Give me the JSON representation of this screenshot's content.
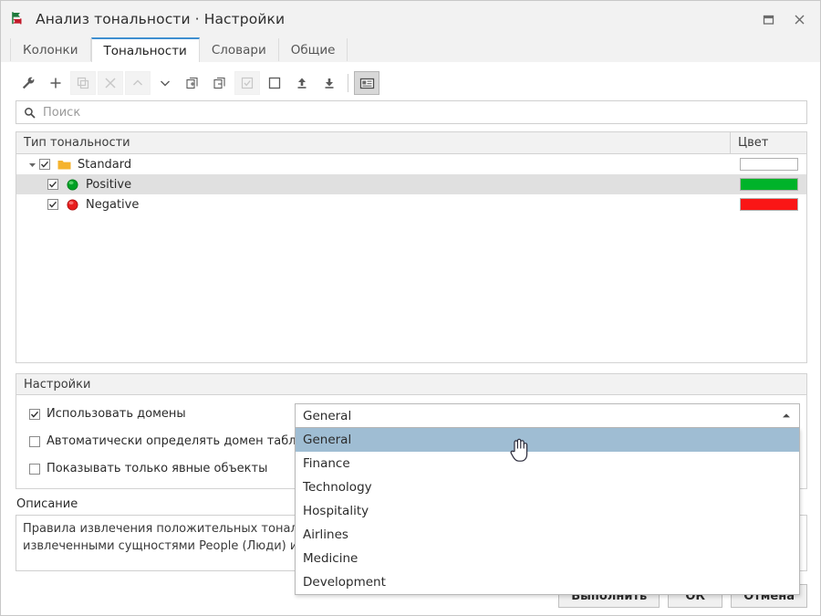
{
  "window": {
    "title": "Анализ тональности · Настройки",
    "app_icon": "sentiment-arrows-icon",
    "controls": [
      {
        "name": "maximize",
        "icon": "maximize-icon"
      },
      {
        "name": "close",
        "icon": "close-icon"
      }
    ]
  },
  "tabs": [
    {
      "label": "Колонки",
      "active": false
    },
    {
      "label": "Тональности",
      "active": true
    },
    {
      "label": "Словари",
      "active": false
    },
    {
      "label": "Общие",
      "active": false
    }
  ],
  "toolbar": {
    "buttons": [
      {
        "name": "settings-wrench-button",
        "icon": "wrench-icon",
        "state": "enabled"
      },
      {
        "name": "add-button",
        "icon": "plus-icon",
        "state": "enabled"
      },
      {
        "name": "duplicate-button",
        "icon": "copy-icon",
        "state": "disabled"
      },
      {
        "name": "delete-button",
        "icon": "close-x-icon",
        "state": "disabled"
      },
      {
        "name": "move-up-button",
        "icon": "chevron-up-icon",
        "state": "disabled"
      },
      {
        "name": "move-down-button",
        "icon": "chevron-down-icon",
        "state": "enabled"
      },
      {
        "name": "expand-all-button",
        "icon": "expand-all-icon",
        "state": "enabled"
      },
      {
        "name": "collapse-all-button",
        "icon": "collapse-all-icon",
        "state": "enabled"
      },
      {
        "name": "check-all-button",
        "icon": "checkbox-checked-icon",
        "state": "disabled"
      },
      {
        "name": "uncheck-all-button",
        "icon": "checkbox-empty-icon",
        "state": "enabled"
      },
      {
        "name": "import-button",
        "icon": "arrow-up-bar-icon",
        "state": "enabled"
      },
      {
        "name": "export-button",
        "icon": "arrow-down-bar-icon",
        "state": "enabled"
      },
      {
        "name": "toolbar-separator",
        "icon": "separator",
        "state": "separator"
      },
      {
        "name": "show-details-toggle",
        "icon": "id-card-icon",
        "state": "pressed"
      }
    ]
  },
  "search": {
    "placeholder": "Поиск",
    "value": "",
    "icon": "search-icon"
  },
  "tree": {
    "columns": [
      {
        "label": "Тип тональности"
      },
      {
        "label": "Цвет"
      }
    ],
    "rows": [
      {
        "label": "Standard",
        "icon": "folder-icon",
        "checked": true,
        "expanded": true,
        "level": 0,
        "selected": false,
        "color": "#ffffff"
      },
      {
        "label": "Positive",
        "icon": "green-sphere-icon",
        "checked": true,
        "level": 1,
        "selected": true,
        "color": "#00b32a"
      },
      {
        "label": "Negative",
        "icon": "red-sphere-icon",
        "checked": true,
        "level": 1,
        "selected": false,
        "color": "#fa1616"
      }
    ]
  },
  "settings": {
    "title": "Настройки",
    "options": [
      {
        "label": "Использовать домены",
        "checked": true
      },
      {
        "label": "Автоматически определять домен таблицы",
        "checked": false
      },
      {
        "label": "Показывать только явные объекты",
        "checked": false
      }
    ]
  },
  "domain_combo": {
    "value": "General",
    "open": true,
    "arrow_icon": "triangle-up-icon",
    "options": [
      {
        "label": "General",
        "highlighted": true
      },
      {
        "label": "Finance",
        "highlighted": false
      },
      {
        "label": "Technology",
        "highlighted": false
      },
      {
        "label": "Hospitality",
        "highlighted": false
      },
      {
        "label": "Airlines",
        "highlighted": false
      },
      {
        "label": "Medicine",
        "highlighted": false
      },
      {
        "label": "Development",
        "highlighted": false
      }
    ]
  },
  "description": {
    "label": "Описание",
    "line1": "Правила извлечения положительных тональнос",
    "line2": "извлеченными сущностями People (Люди) и Co"
  },
  "footer": {
    "run_label": "Выполнить",
    "ok_label": "ОК",
    "cancel_label": "Отмена"
  },
  "cursor": {
    "icon": "pointing-hand-cursor"
  },
  "colors": {
    "accent_tab": "#3f8fd0",
    "selection_row": "#e0e0e0",
    "selection_list": "#9fbdd3",
    "positive": "#00b32a",
    "negative": "#fa1616",
    "folder": "#f5b32e"
  }
}
